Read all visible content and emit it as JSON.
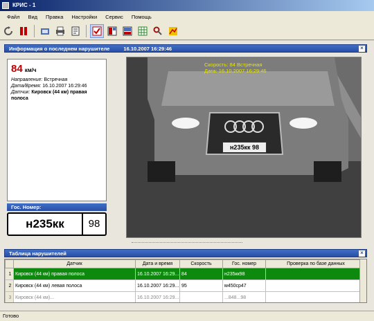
{
  "window": {
    "title": "КРИС - 1"
  },
  "menu": [
    "Файл",
    "Вид",
    "Правка",
    "Настройки",
    "Сервис",
    "Помощь"
  ],
  "toolbar": {
    "icons": [
      "refresh-icon",
      "stop-icon",
      "camera-icon",
      "printer-icon",
      "report-icon",
      "settings-check-icon",
      "layout-icon",
      "layout-alt-icon",
      "grid-icon",
      "key-icon",
      "map-icon"
    ]
  },
  "violation_panel": {
    "title": "Информация о последнем нарушителе",
    "timestamp": "16.10.2007 16:29:46",
    "speed_value": "84",
    "speed_unit": "км/ч",
    "direction_label": "Направление:",
    "direction_value": "Встречная",
    "datetime_label": "Дата/Время:",
    "datetime_value": "16.10.2007 16:29:46",
    "sensor_label": "Датчик:",
    "sensor_value": "Кировск (44 км) правая полоса",
    "plate_label": "Гос. Номер:",
    "plate_number": "н235кк",
    "plate_region": "98"
  },
  "photo": {
    "caption_speed": "Скорость: 84 Встречная",
    "caption_date": "Дата: 16.10.2007 16:29:46",
    "car_plate": "н235кк 98"
  },
  "table": {
    "title": "Таблица нарушителей",
    "columns": [
      "Датчик",
      "Дата и время",
      "Скорость",
      "Гос. номер",
      "Проверка по базе данных"
    ],
    "rows": [
      {
        "idx": "1",
        "sensor": "Кировск (44 км) правая полоса",
        "datetime": "16.10.2007 16:29...",
        "speed": "84",
        "plate": "н235кк98",
        "db": ""
      },
      {
        "idx": "2",
        "sensor": "Кировск (44 км) левая полоса",
        "datetime": "16.10.2007 16:29...",
        "speed": "95",
        "plate": "м450ср47",
        "db": ""
      },
      {
        "idx": "3",
        "sensor": "Кировск (44 км)...",
        "datetime": "16.10.2007 16:29...",
        "speed": "",
        "plate": "...848...98",
        "db": ""
      }
    ]
  },
  "status": {
    "text": "Готово"
  },
  "colors": {
    "accent": "#2a4fa4",
    "speed_red": "#c00000",
    "selected_row": "#0d8a0d",
    "caption_yellow": "#e6e600"
  }
}
